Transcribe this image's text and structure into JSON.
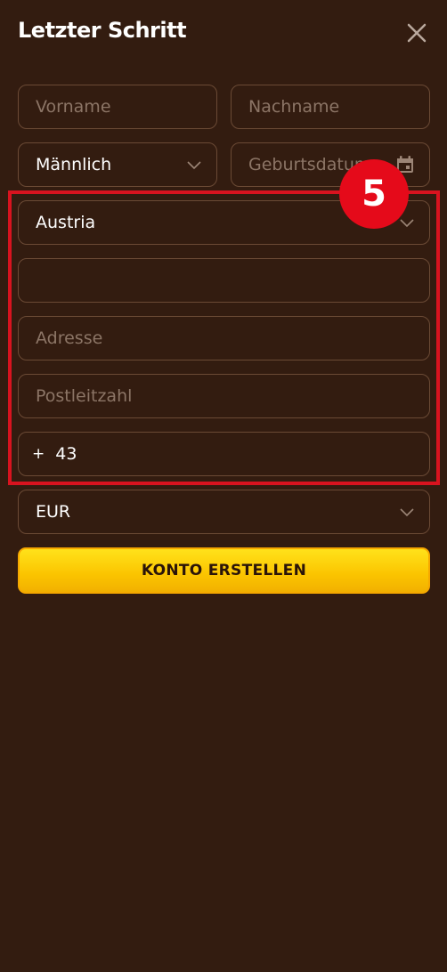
{
  "header": {
    "title": "Letzter Schritt",
    "close_icon": "close-icon"
  },
  "form": {
    "first_name": {
      "placeholder": "Vorname",
      "value": ""
    },
    "last_name": {
      "placeholder": "Nachname",
      "value": ""
    },
    "gender": {
      "value": "Männlich"
    },
    "birthdate": {
      "placeholder": "Geburtsdatum",
      "value": ""
    },
    "country": {
      "value": "Austria"
    },
    "city": {
      "placeholder": "",
      "value": ""
    },
    "address": {
      "placeholder": "Adresse",
      "value": ""
    },
    "postal_code": {
      "placeholder": "Postleitzahl",
      "value": ""
    },
    "phone": {
      "prefix": "+",
      "value": "43"
    },
    "currency": {
      "value": "EUR"
    },
    "submit_label": "KONTO ERSTELLEN"
  },
  "annotation": {
    "step_number": "5",
    "highlight_color": "#d8131f"
  },
  "colors": {
    "background": "#331c10",
    "field_border": "#6b4a35",
    "cta": "#ffd400",
    "badge": "#e50a1a"
  }
}
